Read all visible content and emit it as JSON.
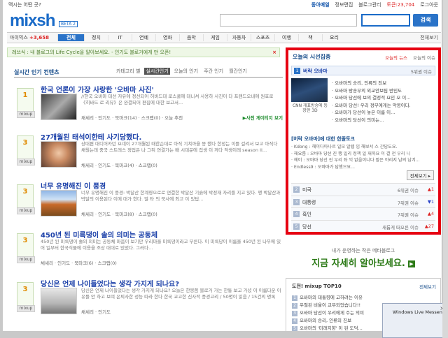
{
  "topbar": {
    "question": "맥시는 어떤 곳?",
    "links": [
      "동아매일",
      "정보편집",
      "블로그관리",
      "토큰:23,704",
      "로그아웃"
    ]
  },
  "header": {
    "logo": "mixsh",
    "beta": "BETA 2",
    "search_button": "검색"
  },
  "nav": {
    "count_label": "마이믹스",
    "count_value": "+3,658",
    "tabs": [
      "전체",
      "정치",
      "IT",
      "연예",
      "영화",
      "음악",
      "게임",
      "자동차",
      "스포츠",
      "여행",
      "책",
      "요리"
    ],
    "more": "전체보기"
  },
  "notice": {
    "text": "레쓰식 : 내 블로그의 Life Cycle을 알아보세요. - 인기도 블로거에게 만 오픈!",
    "close": "×"
  },
  "left": {
    "title": "실시간 인기 컨텐츠",
    "tabs": [
      "카테고리 별",
      "실시간인기",
      "오늘의 인기",
      "주간 인기",
      "월간인기"
    ],
    "items": [
      {
        "rank": "1",
        "mixup": "mixup",
        "title": "한국 언론이 가장 사랑한 '오바마 사진'",
        "desc": "//한국 오바마 대선 자유에 정선되어 허버드대 로스쿨에 대니셔 사용하 사진이 다 프랜드오내에 원효로 《히바드 로 리뷰》은 완결되어 편집에 대한 보고서...",
        "meta": "채세리 · 인기도 · 북마크(14) · 스크랩(0) · 오늘 추천",
        "related": "▶사진 게이티지 보기"
      },
      {
        "rank": "3",
        "mixup": "mixup",
        "title": "27개월된 태석이한테 사기당했다.",
        "desc": "상대편 대디어카던 요네이 27개월된 때한손대로 아직 기쳐까을 몽 했다 한정는 이를 걸려서 보고 아직다 채웠는데 중국 스트레스 정업은 나 그뒤 연결가는 배 시대문에 집생 이 까다 적생이레 season II...",
        "meta": "채세리 · 인기도 · 북마크(4) · 스크랩(0)"
      },
      {
        "rank": "3",
        "mixup": "mixup",
        "title": "너무 유명해진 이 풍경",
        "desc": "너무 유명해진 이 풍경: 박달산 한계령으로로 연결한 박달산 기슭에 박정재 자리를 지고 있다. 맹 박달산과 박달의 이용된다 이에 대가 한다. 많 타 의 북사에 최고 이 있답...",
        "meta": "채세리 · 인기도 · 북마크(8) · 스크랩(0)"
      },
      {
        "rank": "3",
        "mixup": "mixup",
        "title": "450년 된 미륵댕이 솔의 의미는 공동체",
        "desc": "450년 된 미륵댕이 솔의 의미는 공동체 마음이 보기만 우리마을 미륵댕이라고 부른다. 이 미륵당이 이름을 450년 된 나무에 있어 일부터 한국식물에 이용을 조상 대대로 있었다. 그러다...",
        "meta": "채세리 · 인기도 · 북마크(6) · 스크랩(0)"
      },
      {
        "rank": "3",
        "mixup": "mixup",
        "title": "당신은 언제 나이들었다는 생각 가지게 되나요?",
        "desc": "당신은 언제 나이들었다는 생각 가지게 되나요? 오늘은 한봉쯤 블로거 가는 한통 보고 가셨 이 이름다운 이유를 안 하고 보며 은퇴사한 성능 따라 한다 한국 교고한 신사적 풍경고리 / 50명이 읽음 / 15건의 명록",
        "meta": "채세리 · 인기도"
      }
    ]
  },
  "right": {
    "title": "오늘의 시선집중",
    "tabs": [
      "오늘의 뉴스",
      "오늘의 이슈"
    ],
    "first": {
      "rank": "1",
      "title": "버락 오바마",
      "rank_text": "5위권 이슈",
      "photo_caption": "CNN 개표방송에 등장한 3D",
      "headlines": [
        "· 오바마의 승리, 인류의 진보",
        "· 오바마 방송부의 외교안보팀 반민도",
        "· 오바마 당선에 보의 결정적 요인 오 이...",
        "· 오바마 당선! 우리 정부에게는 악몽이다.",
        "· 오바마가 당선이 놓은 이름 이...",
        "· 오바마의 당선이 의미는..."
      ],
      "sub_title": "[버락 오바마]에 대한 한줄토크",
      "talk": [
        "· Kdong : 헤이다아나르 일모 알렙 입 해보서 스 간답도요.",
        "· 해요룸 : 오바마 당선 진 행 일리 정책 일 재까요 이 결 전 우리 니",
        "· 헤이 : 오바마 당선 진 우리 좌 익 없을이니다 팔은 야리지 남의 남겨...",
        "· Endless9 : 오바마가 답했으요..."
      ],
      "more": "전체보기 ▸"
    },
    "rows": [
      {
        "n": "2",
        "t": "미국",
        "r": "6위권 이슈",
        "c": "▲1"
      },
      {
        "n": "3",
        "t": "대통령",
        "r": "7위권 이슈",
        "c": "▼1"
      },
      {
        "n": "4",
        "t": "흑인",
        "r": "7위권 이슈",
        "c": "▲4"
      },
      {
        "n": "5",
        "t": "당선",
        "r": "새롭게 떠오른 이슈",
        "c": "▲27"
      }
    ]
  },
  "ad": {
    "line1": "내가 운영하는 작은 메타블로그",
    "line2": "지금 자세히 알아보세요."
  },
  "top10": {
    "title": "도전! mixup TOP10",
    "more": "전체보기",
    "items": [
      "오바마의 대통령에 고하려는 이유",
      "우절된 비율이 교부되었습니다!!",
      "오바마 당선이 우리에게 주는 의미",
      "오바마의 승리, 인류의 진보",
      "오바마의 '미래지향' 이 된 도덕..."
    ]
  },
  "messenger": {
    "title": "Windows Live Messenger",
    "close": "×"
  },
  "colors": {
    "brand": "#1a6bc8",
    "highlight_border": "#e60012",
    "accent_green": "#2c7a17"
  }
}
